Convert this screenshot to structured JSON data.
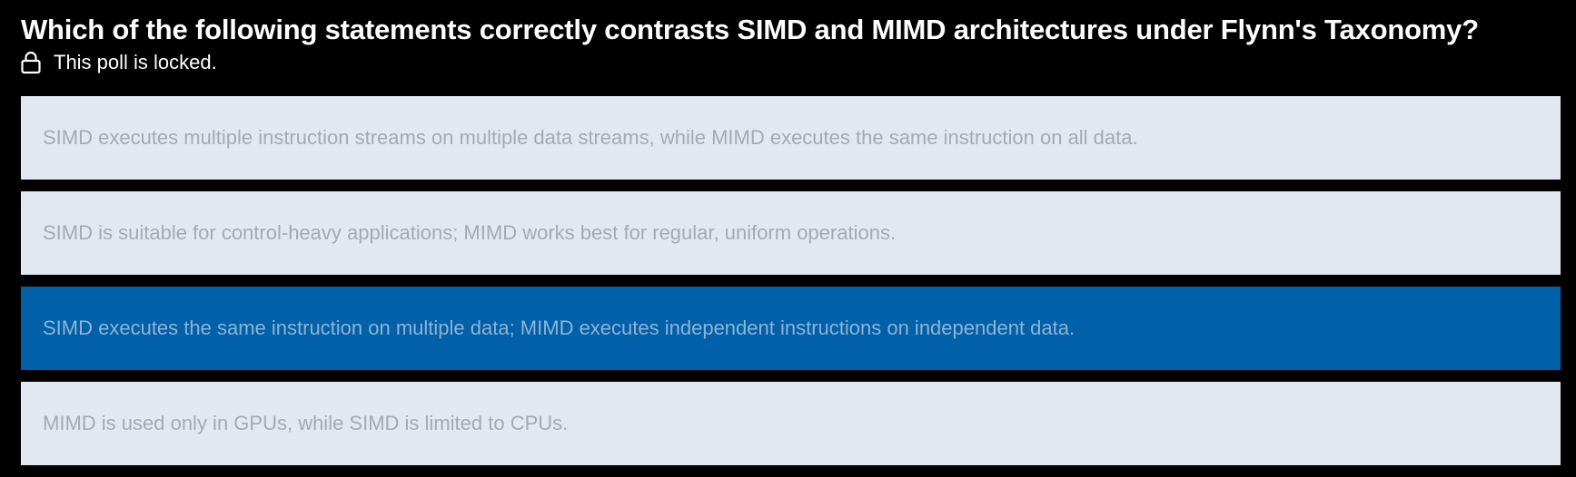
{
  "poll": {
    "question": "Which of the following statements correctly contrasts SIMD and MIMD architectures under Flynn's Taxonomy?",
    "status_icon": "lock-icon",
    "status_text": "This poll is locked.",
    "options": [
      {
        "label": "SIMD executes multiple instruction streams on multiple data streams, while MIMD executes the same instruction on all data.",
        "selected": false
      },
      {
        "label": "SIMD is suitable for control-heavy applications; MIMD works best for regular, uniform operations.",
        "selected": false
      },
      {
        "label": "SIMD executes the same instruction on multiple data; MIMD executes independent instructions on independent data.",
        "selected": true
      },
      {
        "label": "MIMD is used only in GPUs, while SIMD is limited to CPUs.",
        "selected": false
      }
    ]
  },
  "colors": {
    "background": "#000000",
    "option_bg": "#e1e8f0",
    "option_text": "#a3aab3",
    "selected_bg": "#0060a8",
    "selected_text": "#8fb3d6"
  }
}
